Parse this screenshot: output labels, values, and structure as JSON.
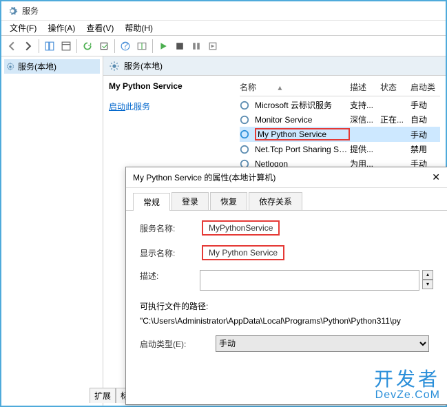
{
  "window": {
    "title": "服务"
  },
  "menu": {
    "file": "文件(F)",
    "action": "操作(A)",
    "view": "查看(V)",
    "help": "帮助(H)"
  },
  "tree": {
    "root": "服务(本地)"
  },
  "content": {
    "header": "服务(本地)"
  },
  "detail": {
    "title": "My Python Service",
    "start_link": "启动",
    "start_suffix": "此服务"
  },
  "columns": {
    "name": "名称",
    "desc": "描述",
    "status": "状态",
    "start": "启动类"
  },
  "sort_icon": "▴",
  "services": [
    {
      "name": "Microsoft 云标识服务",
      "desc": "支持...",
      "status": "",
      "start": "手动"
    },
    {
      "name": "Monitor Service",
      "desc": "深信...",
      "status": "正在...",
      "start": "自动"
    },
    {
      "name": "My Python Service",
      "desc": "",
      "status": "",
      "start": "手动"
    },
    {
      "name": "Net.Tcp Port Sharing Ser...",
      "desc": "提供...",
      "status": "",
      "start": "禁用"
    },
    {
      "name": "Netlogon",
      "desc": "为用...",
      "status": "",
      "start": "手动"
    }
  ],
  "ext_tabs": {
    "extended": "扩展",
    "standard": "标"
  },
  "dialog": {
    "title": "My Python Service 的属性(本地计算机)",
    "close": "✕",
    "tabs": {
      "general": "常规",
      "logon": "登录",
      "recovery": "恢复",
      "deps": "依存关系"
    },
    "service_name_label": "服务名称:",
    "service_name_value": "MyPythonService",
    "display_name_label": "显示名称:",
    "display_name_value": "My Python Service",
    "desc_label": "描述:",
    "desc_value": "",
    "path_label": "可执行文件的路径:",
    "path_value": "\"C:\\Users\\Administrator\\AppData\\Local\\Programs\\Python\\Python311\\py",
    "startup_label": "启动类型(E):",
    "startup_value": "手动"
  },
  "watermark": {
    "line1": "开发者",
    "line2": "DevZe.CoM"
  }
}
